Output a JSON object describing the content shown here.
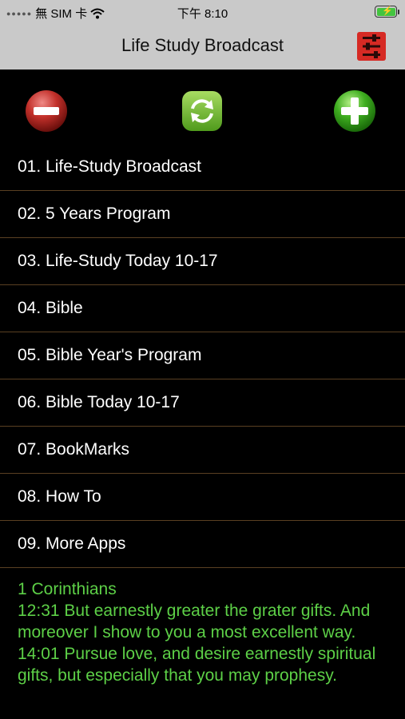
{
  "status": {
    "carrier": "無 SIM 卡",
    "time": "下午 8:10",
    "signal_icon": "signal-dots-icon",
    "wifi_icon": "wifi-icon",
    "battery_icon": "battery-charging-icon"
  },
  "nav": {
    "title": "Life Study Broadcast",
    "settings_icon": "sliders-icon"
  },
  "actions": {
    "remove_icon": "minus-circle-icon",
    "refresh_icon": "refresh-icon",
    "add_icon": "plus-circle-icon"
  },
  "menu": {
    "items": [
      {
        "label": "01. Life-Study Broadcast"
      },
      {
        "label": "02. 5 Years Program"
      },
      {
        "label": "03. Life-Study Today  10-17"
      },
      {
        "label": "04. Bible"
      },
      {
        "label": "05. Bible Year's Program"
      },
      {
        "label": "06. Bible Today  10-17"
      },
      {
        "label": "07. BookMarks"
      },
      {
        "label": "08. How To"
      },
      {
        "label": "09. More Apps"
      }
    ]
  },
  "verse": {
    "book": "1 Corinthians",
    "line1": "12:31 But earnestly greater the grater gifts. And moreover I show to you a most excellent way.",
    "line2": "14:01 Pursue love, and desire earnestly spiritual gifts, but especially that you may prophesy."
  },
  "colors": {
    "bar_bg": "#c9c9c9",
    "background": "#000000",
    "divider": "#5a4022",
    "verse_text": "#5dd047",
    "settings_red": "#d62a24"
  }
}
